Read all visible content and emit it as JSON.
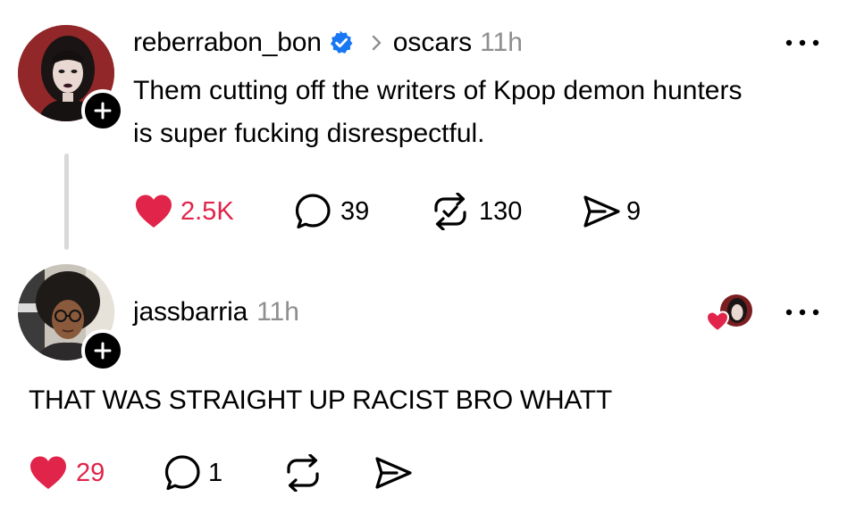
{
  "colors": {
    "accent_like": "#e0244a",
    "verified": "#1877f2",
    "muted": "#8e8e8e",
    "thread_line": "#d9d9d9"
  },
  "post": {
    "username": "reberrabon_bon",
    "verified": true,
    "community": "oscars",
    "time": "11h",
    "text_line1": "Them cutting off the writers of Kpop demon hunters",
    "text_line2": "is super fucking disrespectful.",
    "likes": "2.5K",
    "liked": true,
    "replies": "39",
    "reposts": "130",
    "shares": "9",
    "icons": [
      "heart-filled-icon",
      "comment-icon",
      "repost-icon",
      "share-icon",
      "more-icon",
      "verified-badge-icon",
      "chevron-right-icon",
      "plus-icon"
    ]
  },
  "reply": {
    "username": "jassbarria",
    "time": "11h",
    "text": "THAT WAS STRAIGHT UP RACIST BRO WHATT",
    "likes": "29",
    "liked": true,
    "replies": "1",
    "reposts": "",
    "shares": "",
    "author_liked": true,
    "icons": [
      "heart-filled-icon",
      "comment-icon",
      "repost-icon",
      "share-icon",
      "more-icon",
      "author-liked-heart-icon",
      "plus-icon"
    ]
  }
}
